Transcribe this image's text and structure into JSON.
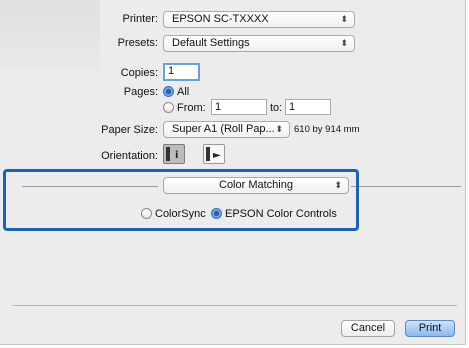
{
  "printer": {
    "label": "Printer:",
    "value": "EPSON SC-TXXXX"
  },
  "presets": {
    "label": "Presets:",
    "value": "Default Settings"
  },
  "copies": {
    "label": "Copies:",
    "value": "1"
  },
  "pages": {
    "label": "Pages:",
    "all_label": "All",
    "from_label": "From:",
    "from_value": "1",
    "to_label": "to:",
    "to_value": "1",
    "selected": "All"
  },
  "paper_size": {
    "label": "Paper Size:",
    "value": "Super A1 (Roll Pap...",
    "dimensions": "610 by 914 mm"
  },
  "orientation": {
    "label": "Orientation:",
    "selected": "portrait"
  },
  "section": {
    "value": "Color Matching"
  },
  "color_mode": {
    "options": [
      "ColorSync",
      "EPSON Color Controls"
    ],
    "selected": "EPSON Color Controls"
  },
  "buttons": {
    "cancel": "Cancel",
    "print": "Print"
  },
  "colors": {
    "highlight": "#1e63b0",
    "primary_button": "#8bb7ec"
  }
}
